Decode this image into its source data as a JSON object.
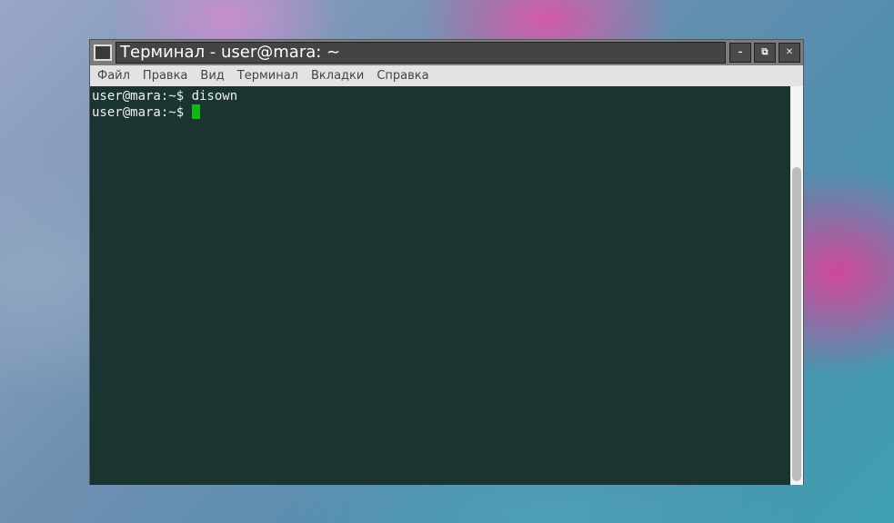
{
  "window": {
    "title": "Терминал - user@mara: ~",
    "minimize": "–",
    "restore": "⧉",
    "close": "✕"
  },
  "menu": [
    "Файл",
    "Правка",
    "Вид",
    "Терминал",
    "Вкладки",
    "Справка"
  ],
  "terminal": {
    "lines": [
      {
        "prompt": "user@mara:~$ ",
        "command": "disown"
      },
      {
        "prompt": "user@mara:~$ ",
        "command": ""
      }
    ],
    "cursor_color": "#11b811",
    "background": "#193431"
  },
  "scrollbar": {
    "position_fraction": 1.0
  }
}
